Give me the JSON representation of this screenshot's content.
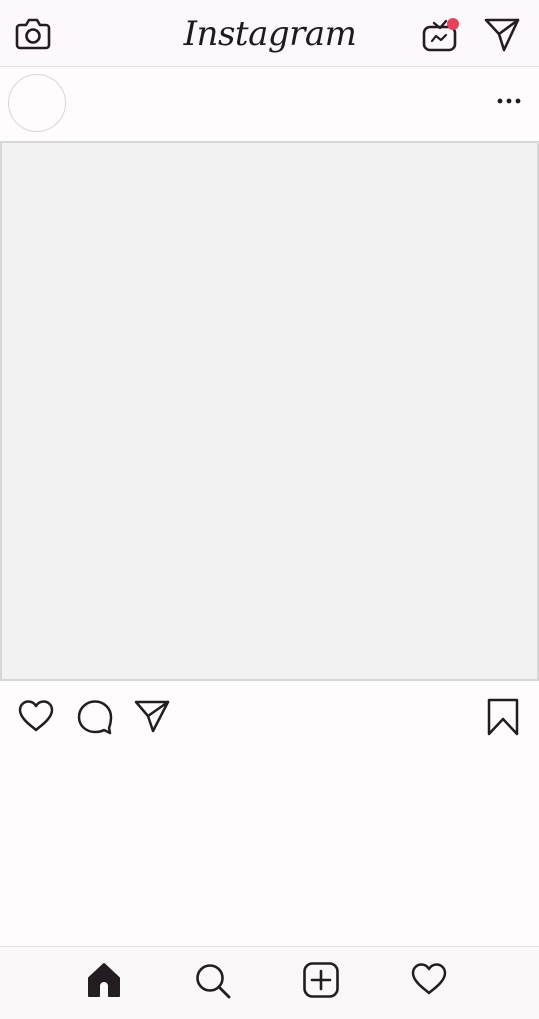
{
  "app": {
    "logo_text": "Instagram"
  },
  "top_bar": {
    "left_icon": "camera-icon",
    "right_icons": [
      "igtv-icon",
      "direct-message-icon"
    ],
    "notification_dot_color": "#e8415a"
  },
  "post": {
    "header_icons": [
      "avatar",
      "more-options-icon"
    ],
    "image_placeholder_color": "#f2f2f2",
    "actions": [
      "heart-icon",
      "comment-icon",
      "share-icon",
      "bookmark-icon"
    ]
  },
  "bottom_nav": {
    "items": [
      "home-icon",
      "search-icon",
      "new-post-icon",
      "activity-heart-icon"
    ],
    "active": "home-icon"
  }
}
